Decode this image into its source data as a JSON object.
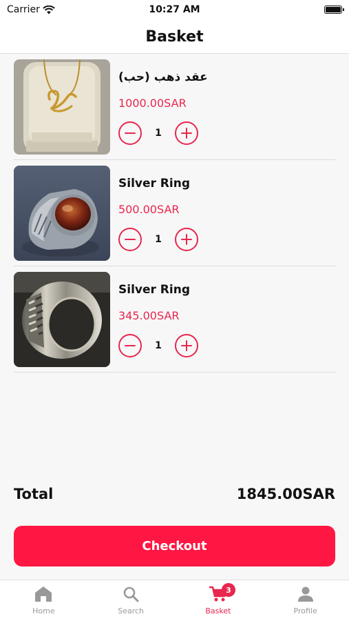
{
  "status_bar": {
    "carrier": "Carrier",
    "time": "10:27 AM"
  },
  "header": {
    "title": "Basket"
  },
  "cart": {
    "items": [
      {
        "name": "عقد ذهب (حب)",
        "price": "1000.00SAR",
        "quantity": "1",
        "image": "gold-necklace"
      },
      {
        "name": "Silver Ring",
        "price": "500.00SAR",
        "quantity": "1",
        "image": "silver-ring-agate"
      },
      {
        "name": "Silver Ring",
        "price": "345.00SAR",
        "quantity": "1",
        "image": "silver-band-ring"
      }
    ]
  },
  "summary": {
    "total_label": "Total",
    "total_value": "1845.00SAR"
  },
  "checkout": {
    "label": "Checkout"
  },
  "tabs": [
    {
      "label": "Home",
      "icon": "home-icon"
    },
    {
      "label": "Search",
      "icon": "search-icon"
    },
    {
      "label": "Basket",
      "icon": "cart-icon",
      "badge": "3"
    },
    {
      "label": "Profile",
      "icon": "profile-icon"
    }
  ],
  "colors": {
    "accent": "#e8264e",
    "checkout": "#ff1744",
    "inactive": "#999999"
  }
}
